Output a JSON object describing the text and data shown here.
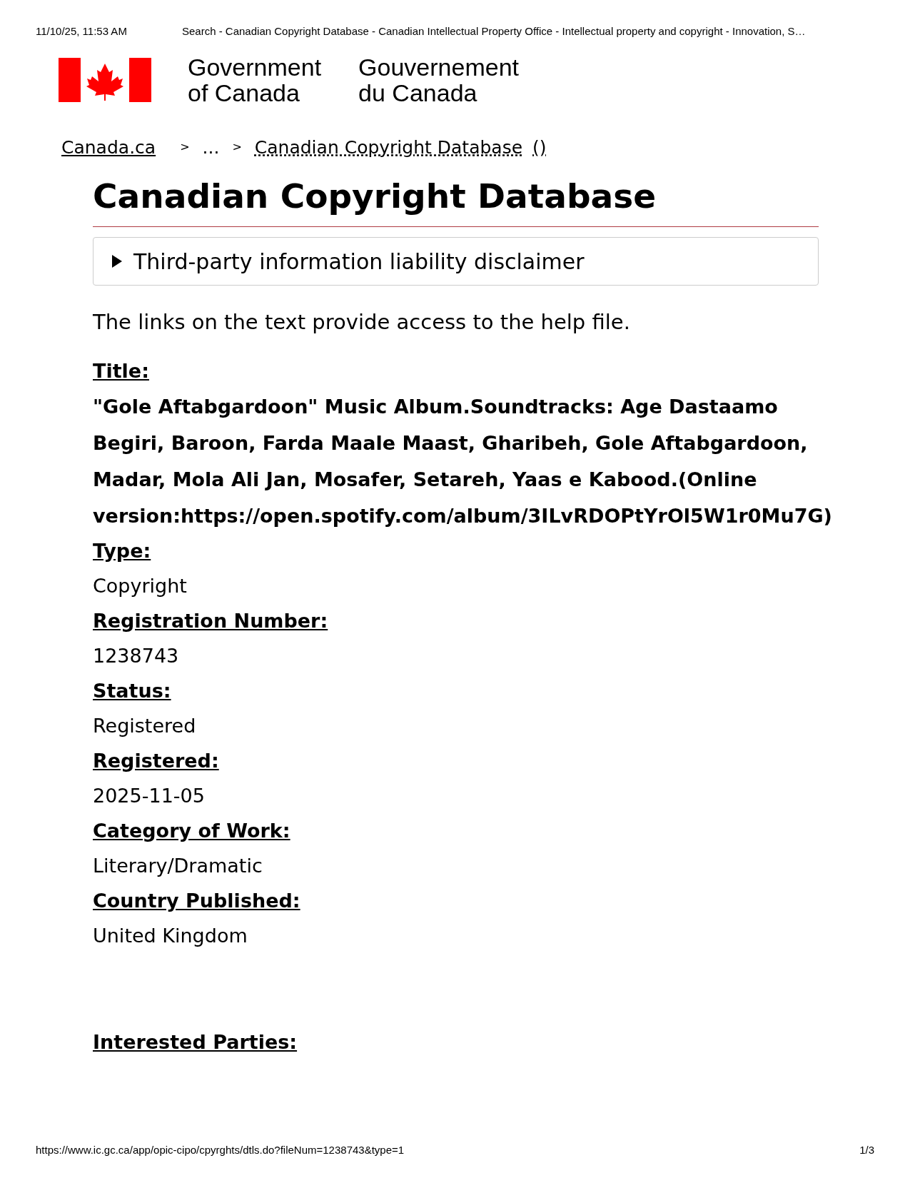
{
  "print_header": {
    "date": "11/10/25, 11:53 AM",
    "page_title": "Search - Canadian Copyright Database - Canadian Intellectual Property Office - Intellectual property and copyright - Innovation, S…"
  },
  "signature": {
    "english": [
      "Government",
      "of Canada"
    ],
    "french": [
      "Gouvernement",
      "du Canada"
    ]
  },
  "breadcrumbs": [
    {
      "label": "Canada.ca",
      "kind": "link"
    },
    {
      "label": ">",
      "kind": "separator"
    },
    {
      "label": "...",
      "kind": "text"
    },
    {
      "label": ">",
      "kind": "separator"
    },
    {
      "label": "Canadian Copyright Database",
      "kind": "abbr"
    },
    {
      "label": "()",
      "kind": "abbr"
    }
  ],
  "heading": "Canadian Copyright Database",
  "disclaimer": {
    "summary": "Third-party information liability disclaimer",
    "expanded": false
  },
  "intro": "The links on the text provide access to the help file.",
  "fields": [
    {
      "label": "Title:",
      "value": "\"Gole Aftabgardoon\" Music Album.Soundtracks: Age Dastaamo Begiri, Baroon, Farda Maale Maast, Gharibeh, Gole Aftabgardoon, Madar, Mola Ali Jan, Mosafer, Setareh, Yaas e Kabood.(Online version:https://open.spotify.com/album/3ILvRDOPtYrOl5W1r0Mu7G)",
      "bold": true
    },
    {
      "label": "Type:",
      "value": "Copyright",
      "bold": false
    },
    {
      "label": "Registration Number:",
      "value": "1238743",
      "bold": false
    },
    {
      "label": "Status:",
      "value": "Registered",
      "bold": false
    },
    {
      "label": "Registered:",
      "value": "2025-11-05",
      "bold": false
    },
    {
      "label": "Category of Work:",
      "value": "Literary/Dramatic",
      "bold": false
    },
    {
      "label": "Country Published:",
      "value": "United Kingdom",
      "bold": false
    }
  ],
  "interested_parties": {
    "label": "Interested Parties:"
  },
  "print_footer": {
    "url": "https://www.ic.gc.ca/app/opic-cipo/cpyrghts/dtls.do?fileNum=1238743&type=1",
    "page": "1/3"
  }
}
